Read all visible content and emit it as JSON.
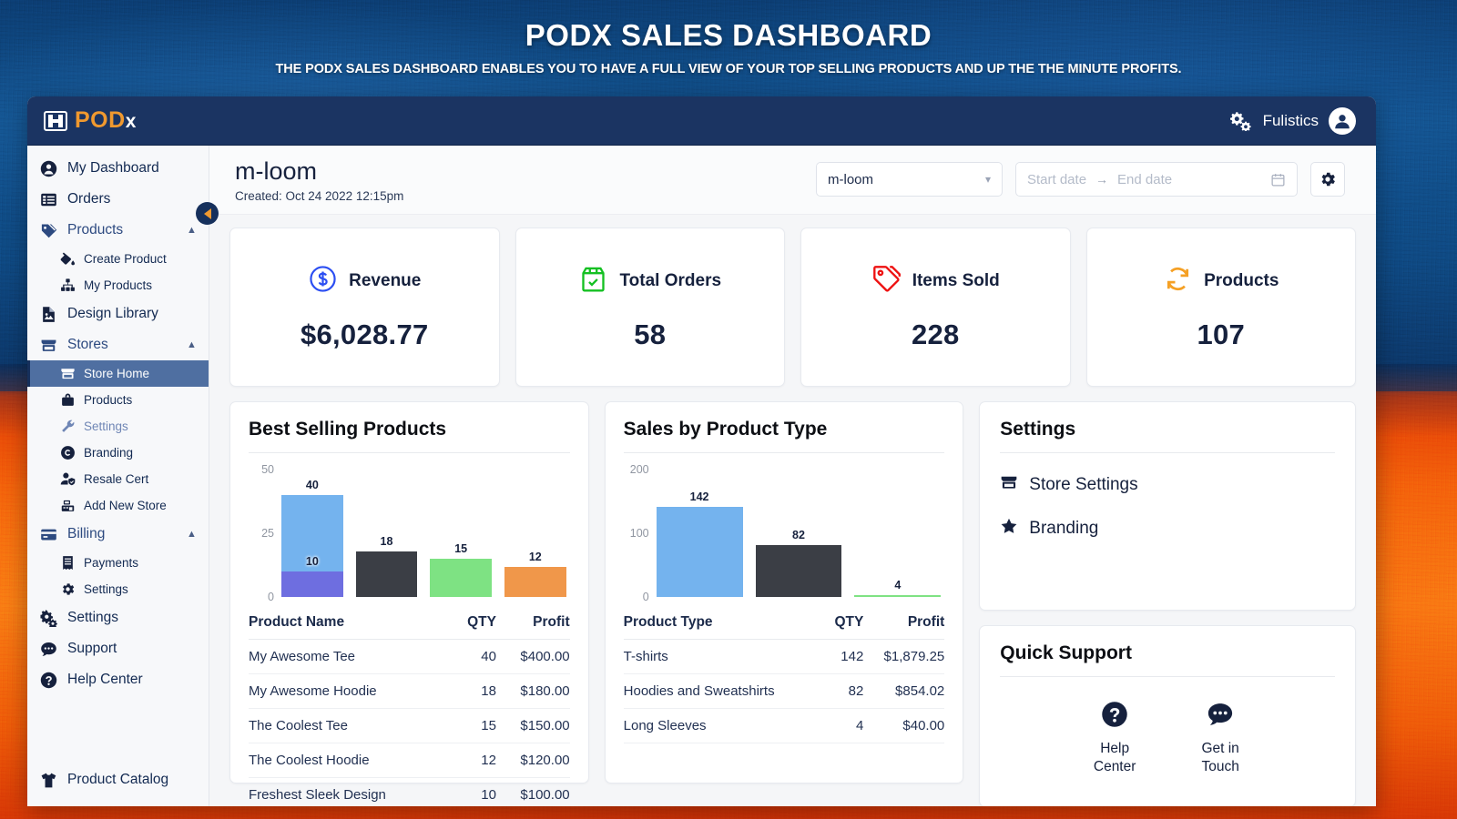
{
  "banner": {
    "title": "PODX SALES DASHBOARD",
    "subtitle": "THE PODX SALES DASHBOARD ENABLES YOU TO HAVE A FULL VIEW OF YOUR TOP SELLING PRODUCTS AND UP THE THE MINUTE PROFITS."
  },
  "topbar": {
    "logo_pod": "POD",
    "logo_x": "x",
    "user_name": "Fulistics",
    "settings_icon": "gears-icon",
    "avatar_icon": "user-avatar-icon"
  },
  "sidebar": {
    "items": [
      {
        "label": "My Dashboard",
        "icon": "user-circle-icon",
        "level": 0,
        "state": "normal"
      },
      {
        "label": "Orders",
        "icon": "list-icon",
        "level": 0,
        "state": "normal"
      },
      {
        "label": "Products",
        "icon": "tags-icon",
        "level": 0,
        "state": "expanded",
        "chevron": "chevron-up-icon"
      },
      {
        "label": "Create Product",
        "icon": "paint-bucket-icon",
        "level": 1,
        "state": "normal"
      },
      {
        "label": "My Products",
        "icon": "sitemap-icon",
        "level": 1,
        "state": "normal"
      },
      {
        "label": "Design Library",
        "icon": "image-file-icon",
        "level": 0,
        "state": "normal"
      },
      {
        "label": "Stores",
        "icon": "store-icon",
        "level": 0,
        "state": "expanded",
        "chevron": "chevron-up-icon"
      },
      {
        "label": "Store Home",
        "icon": "storefront-icon",
        "level": 1,
        "state": "active"
      },
      {
        "label": "Products",
        "icon": "bag-icon",
        "level": 1,
        "state": "normal"
      },
      {
        "label": "Settings",
        "icon": "wrench-icon",
        "level": 1,
        "state": "muted"
      },
      {
        "label": "Branding",
        "icon": "copyright-icon",
        "level": 1,
        "state": "normal"
      },
      {
        "label": "Resale Cert",
        "icon": "user-shield-icon",
        "level": 1,
        "state": "normal"
      },
      {
        "label": "Add New Store",
        "icon": "cash-register-icon",
        "level": 1,
        "state": "normal"
      },
      {
        "label": "Billing",
        "icon": "credit-card-icon",
        "level": 0,
        "state": "expanded",
        "chevron": "chevron-up-icon"
      },
      {
        "label": "Payments",
        "icon": "receipt-icon",
        "level": 1,
        "state": "normal"
      },
      {
        "label": "Settings",
        "icon": "gear-icon",
        "level": 1,
        "state": "normal"
      },
      {
        "label": "Settings",
        "icon": "gears-icon",
        "level": 0,
        "state": "normal"
      },
      {
        "label": "Support",
        "icon": "chat-bubble-icon",
        "level": 0,
        "state": "normal"
      },
      {
        "label": "Help Center",
        "icon": "question-circle-icon",
        "level": 0,
        "state": "normal"
      }
    ],
    "bottom_item": {
      "label": "Product Catalog",
      "icon": "tshirt-icon"
    },
    "collapse_icon": "collapse-left-icon"
  },
  "header": {
    "store_name": "m-loom",
    "created_text": "Created: Oct 24 2022 12:15pm",
    "back_icon": "back-arrow-icon",
    "store_select_value": "m-loom",
    "store_select_chevron": "chevron-down-icon",
    "start_date_placeholder": "Start date",
    "end_date_placeholder": "End date",
    "date_range_arrow": "→",
    "calendar_icon": "calendar-icon",
    "settings_button_icon": "gear-icon"
  },
  "stats": [
    {
      "label": "Revenue",
      "value": "$6,028.77",
      "icon": "dollar-circle-icon",
      "color": "#2b4ef2"
    },
    {
      "label": "Total Orders",
      "value": "58",
      "icon": "box-check-icon",
      "color": "#14c022"
    },
    {
      "label": "Items Sold",
      "value": "228",
      "icon": "price-tag-icon",
      "color": "#ee1111"
    },
    {
      "label": "Products",
      "value": "107",
      "icon": "refresh-icon",
      "color": "#f5a024"
    }
  ],
  "chart_data": [
    {
      "type": "bar",
      "title": "Best Selling Products",
      "categories": [
        "My Awesome Tee",
        "My Awesome Hoodie",
        "The Coolest Tee",
        "The Coolest Hoodie"
      ],
      "values": [
        40,
        18,
        15,
        12
      ],
      "stacked_overlay": {
        "category_index": 0,
        "value": 10,
        "label": "10",
        "color": "#6e6ee0"
      },
      "bar_colors": [
        "#74b3ee",
        "#3b3e45",
        "#7ee283",
        "#f0974a"
      ],
      "data_labels": [
        "40",
        "18",
        "15",
        "12"
      ],
      "yticks": [
        0,
        25,
        50
      ],
      "ytick_labels": [
        "0",
        "25",
        "50"
      ],
      "ylim": [
        0,
        50
      ],
      "xlabel": "",
      "ylabel": "",
      "grid": false,
      "legend": "none"
    },
    {
      "type": "bar",
      "title": "Sales by Product Type",
      "categories": [
        "T-shirts",
        "Hoodies and Sweatshirts",
        "Long Sleeves"
      ],
      "values": [
        142,
        82,
        4
      ],
      "bar_colors": [
        "#74b3ee",
        "#3b3e45",
        "#7ee283"
      ],
      "data_labels": [
        "142",
        "82",
        "4"
      ],
      "yticks": [
        0,
        100,
        200
      ],
      "ytick_labels": [
        "0",
        "100",
        "200"
      ],
      "ylim": [
        0,
        200
      ],
      "xlabel": "",
      "ylabel": "",
      "grid": false,
      "legend": "none"
    }
  ],
  "best_selling": {
    "title": "Best Selling Products",
    "columns": [
      "Product Name",
      "QTY",
      "Profit"
    ],
    "rows": [
      [
        "My Awesome Tee",
        "40",
        "$400.00"
      ],
      [
        "My Awesome Hoodie",
        "18",
        "$180.00"
      ],
      [
        "The Coolest Tee",
        "15",
        "$150.00"
      ],
      [
        "The Coolest Hoodie",
        "12",
        "$120.00"
      ],
      [
        "Freshest Sleek Design",
        "10",
        "$100.00"
      ]
    ]
  },
  "sales_by_type": {
    "title": "Sales by Product Type",
    "columns": [
      "Product Type",
      "QTY",
      "Profit"
    ],
    "rows": [
      [
        "T-shirts",
        "142",
        "$1,879.25"
      ],
      [
        "Hoodies and Sweatshirts",
        "82",
        "$854.02"
      ],
      [
        "Long Sleeves",
        "4",
        "$40.00"
      ]
    ]
  },
  "settings_panel": {
    "title": "Settings",
    "links": [
      {
        "label": "Store Settings",
        "icon": "store-icon"
      },
      {
        "label": "Branding",
        "icon": "star-icon"
      }
    ]
  },
  "quick_support": {
    "title": "Quick Support",
    "items": [
      {
        "label": "Help\nCenter",
        "line1": "Help",
        "line2": "Center",
        "icon": "question-circle-icon"
      },
      {
        "label": "Get in\nTouch",
        "line1": "Get in",
        "line2": "Touch",
        "icon": "chat-bubble-icon"
      }
    ]
  }
}
